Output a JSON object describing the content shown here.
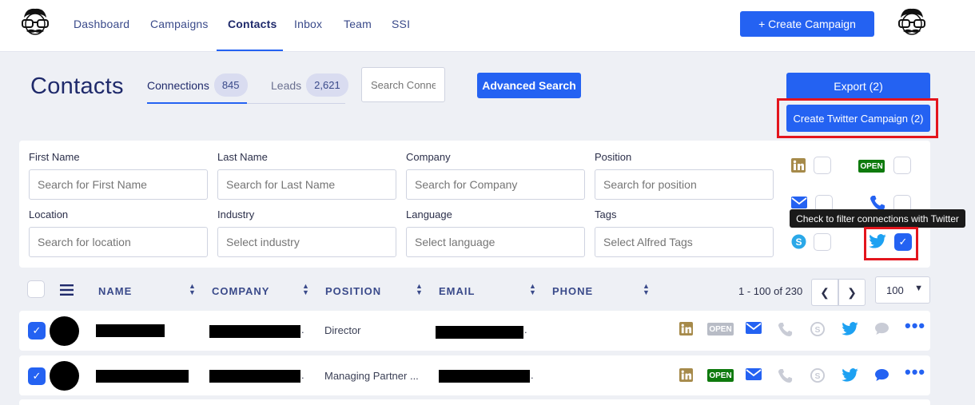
{
  "nav": {
    "items": [
      {
        "label": "Dashboard"
      },
      {
        "label": "Campaigns"
      },
      {
        "label": "Contacts"
      },
      {
        "label": "Inbox"
      },
      {
        "label": "Team"
      },
      {
        "label": "SSI"
      }
    ],
    "active": "Contacts",
    "create_campaign": "+ Create Campaign"
  },
  "header": {
    "title": "Contacts",
    "tabs": [
      {
        "label": "Connections",
        "count": "845"
      },
      {
        "label": "Leads",
        "count": "2,621"
      }
    ],
    "search_placeholder": "Search Connections",
    "advanced_search": "Advanced Search",
    "export": "Export (2)",
    "create_twitter": "Create Twitter Campaign (2)"
  },
  "filters": {
    "first_name": {
      "label": "First Name",
      "placeholder": "Search for First Name"
    },
    "last_name": {
      "label": "Last Name",
      "placeholder": "Search for Last Name"
    },
    "company": {
      "label": "Company",
      "placeholder": "Search for Company"
    },
    "position": {
      "label": "Position",
      "placeholder": "Search for position"
    },
    "location": {
      "label": "Location",
      "placeholder": "Search for location"
    },
    "industry": {
      "label": "Industry",
      "placeholder": "Select industry"
    },
    "language": {
      "label": "Language",
      "placeholder": "Select language"
    },
    "tags": {
      "label": "Tags",
      "placeholder": "Select Alfred Tags"
    },
    "open_badge": "OPEN",
    "tooltip": "Check to filter connections with Twitter"
  },
  "table": {
    "columns": [
      "NAME",
      "COMPANY",
      "POSITION",
      "EMAIL",
      "PHONE"
    ],
    "pagination": "1 - 100 of 230",
    "per_page": "100",
    "rows": [
      {
        "position": "Director",
        "open": "OPEN",
        "open_active": false
      },
      {
        "position": "Managing Partner ...",
        "open": "OPEN",
        "open_active": true
      }
    ]
  },
  "colors": {
    "accent": "#2462f2",
    "linkedin": "#a68a4a",
    "twitter": "#1da1f2",
    "skype": "#2aa8e8",
    "open_green": "#0e7a0d",
    "highlight_red": "#e3151d"
  }
}
